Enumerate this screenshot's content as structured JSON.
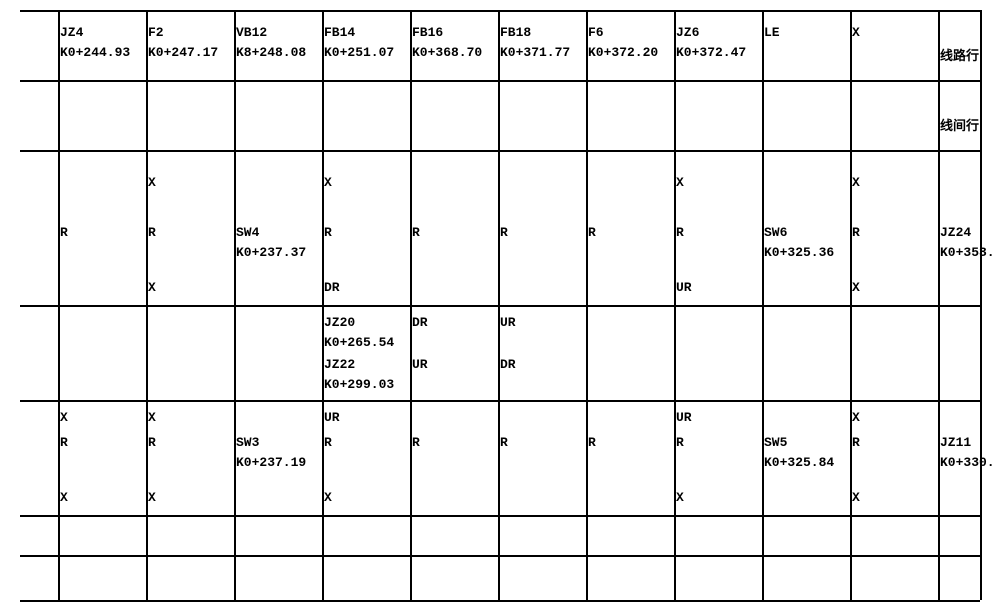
{
  "cols": [
    50,
    138,
    226,
    314,
    402,
    490,
    578,
    666,
    754,
    842,
    930
  ],
  "col_vlines": [
    48,
    136,
    224,
    312,
    400,
    488,
    576,
    664,
    752,
    840,
    928
  ],
  "hlines": [
    10,
    80,
    150,
    305,
    400,
    515,
    555,
    600
  ],
  "row_label_line1": "线路行",
  "row_label_line2": "线间行",
  "header": {
    "labels": [
      "JZ4",
      "F2",
      "VB12",
      "FB14",
      "FB16",
      "FB18",
      "F6",
      "JZ6",
      "LE",
      "X",
      ""
    ],
    "subs": [
      "K0+244.93",
      "K0+247.17",
      "K8+248.08",
      "K0+251.07",
      "K0+368.70",
      "K0+371.77",
      "K0+372.20",
      "K0+372.47",
      "",
      "",
      ""
    ]
  },
  "block1": {
    "r1": [
      "",
      "X",
      "",
      "X",
      "",
      "",
      "",
      "X",
      "",
      "X",
      ""
    ],
    "r2": [
      "R",
      "R",
      "SW4",
      "R",
      "R",
      "R",
      "R",
      "R",
      "SW6",
      "R",
      "JZ24"
    ],
    "r3": [
      "",
      "",
      "K0+237.37",
      "",
      "",
      "",
      "",
      "",
      "K0+325.36",
      "",
      "K0+353."
    ],
    "r4": [
      "",
      "X",
      "",
      "DR",
      "",
      "",
      "",
      "UR",
      "",
      "X",
      ""
    ]
  },
  "mid": {
    "r1": [
      "",
      "",
      "",
      "JZ20",
      "DR",
      "UR",
      "",
      "",
      "",
      "",
      ""
    ],
    "r2": [
      "",
      "",
      "",
      "K0+265.54",
      "",
      "",
      "",
      "",
      "",
      "",
      ""
    ],
    "r3": [
      "",
      "",
      "",
      "JZ22",
      "UR",
      "DR",
      "",
      "",
      "",
      "",
      ""
    ],
    "r4": [
      "",
      "",
      "",
      "K0+299.03",
      "",
      "",
      "",
      "",
      "",
      "",
      ""
    ]
  },
  "block2": {
    "r1": [
      "X",
      "X",
      "",
      "UR",
      "",
      "",
      "",
      "UR",
      "",
      "X",
      ""
    ],
    "r2": [
      "R",
      "R",
      "SW3",
      "R",
      "R",
      "R",
      "R",
      "R",
      "SW5",
      "R",
      "JZ11"
    ],
    "r3": [
      "",
      "",
      "K0+237.19",
      "",
      "",
      "",
      "",
      "",
      "K0+325.84",
      "",
      "K0+330."
    ],
    "r4": [
      "X",
      "X",
      "",
      "X",
      "",
      "",
      "",
      "X",
      "",
      "X",
      ""
    ]
  }
}
